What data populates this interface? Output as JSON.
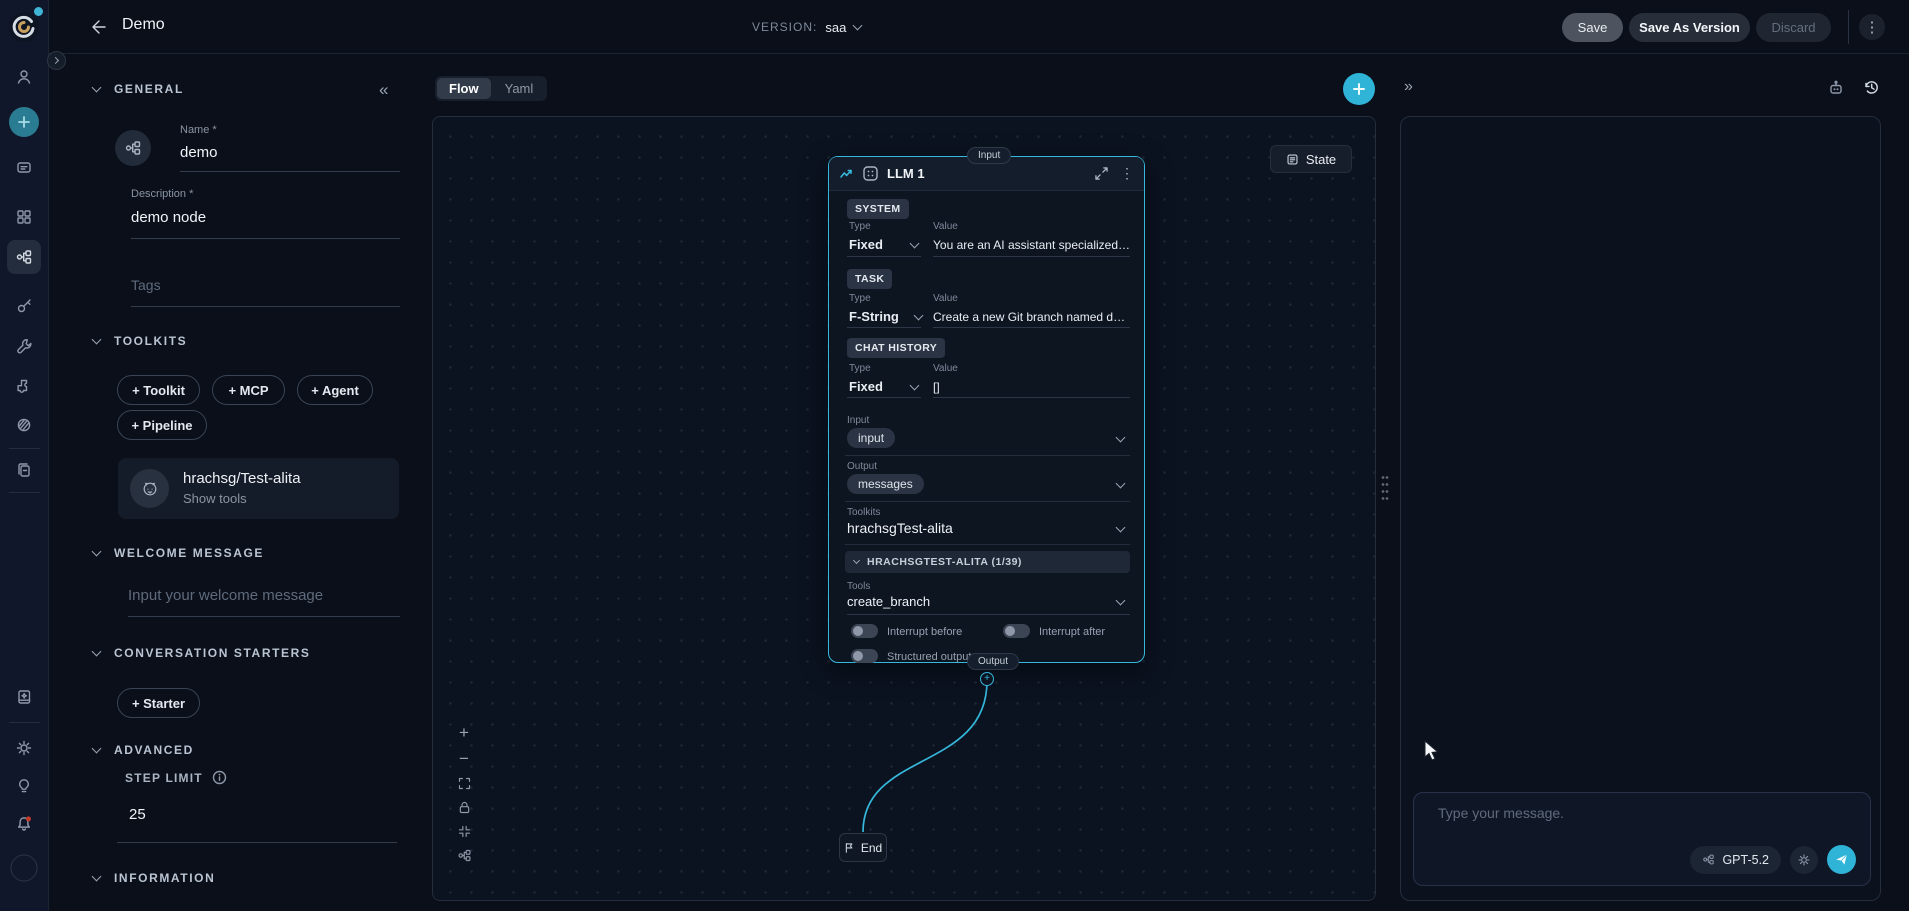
{
  "topbar": {
    "title": "Demo",
    "version_label": "VERSION:",
    "version_value": "saa",
    "save": "Save",
    "save_as": "Save As Version",
    "discard": "Discard"
  },
  "tabs": {
    "flow": "Flow",
    "yaml": "Yaml"
  },
  "sidebar": {
    "general_header": "GENERAL",
    "name_label": "Name *",
    "name_value": "demo",
    "description_label": "Description *",
    "description_value": "demo node",
    "tags_placeholder": "Tags",
    "toolkits_header": "TOOLKITS",
    "add_toolkit": "+ Toolkit",
    "add_mcp": "+ MCP",
    "add_agent": "+ Agent",
    "add_pipeline": "+ Pipeline",
    "toolkit_name": "hrachsg/Test-alita",
    "toolkit_action": "Show tools",
    "welcome_header": "WELCOME MESSAGE",
    "welcome_placeholder": "Input your welcome message",
    "starters_header": "CONVERSATION STARTERS",
    "add_starter": "+ Starter",
    "advanced_header": "ADVANCED",
    "step_limit_label": "STEP LIMIT",
    "step_limit_value": "25",
    "information_header": "INFORMATION"
  },
  "canvas": {
    "input_pill": "Input",
    "output_pill": "Output",
    "state_button": "State",
    "end_node": "End"
  },
  "node": {
    "title": "LLM 1",
    "system_chip": "SYSTEM",
    "system_type_label": "Type",
    "system_type_value": "Fixed",
    "system_value_label": "Value",
    "system_value": "You are an AI assistant specialized in …",
    "task_chip": "TASK",
    "task_type_label": "Type",
    "task_type_value": "F-String",
    "task_value_label": "Value",
    "task_value": "Create a new Git branch named demo.",
    "ch_chip": "CHAT HISTORY",
    "ch_type_label": "Type",
    "ch_type_value": "Fixed",
    "ch_value_label": "Value",
    "ch_value": "[]",
    "input_label": "Input",
    "input_value": "input",
    "output_label": "Output",
    "output_value": "messages",
    "toolkits_label": "Toolkits",
    "toolkits_value": "hrachsgTest-alita",
    "group_header": "HRACHSGTEST-ALITA (1/39)",
    "tools_label": "Tools",
    "tools_value": "create_branch",
    "toggle_interrupt_before": "Interrupt before",
    "toggle_interrupt_after": "Interrupt after",
    "toggle_structured_output": "Structured output"
  },
  "chat": {
    "placeholder": "Type your message.",
    "model": "GPT-5.2"
  },
  "icons": {
    "rail": [
      "user-icon",
      "create-plus-icon",
      "chat-icon",
      "apps-grid-icon",
      "flow-icon",
      "key-icon",
      "wrench-icon",
      "puzzle-icon",
      "collections-icon",
      "copy-pages-icon",
      "book-sparkle-icon",
      "gear-icon",
      "lightbulb-icon",
      "bell-icon",
      "avatar"
    ],
    "accent_color": "#37b8dd"
  }
}
